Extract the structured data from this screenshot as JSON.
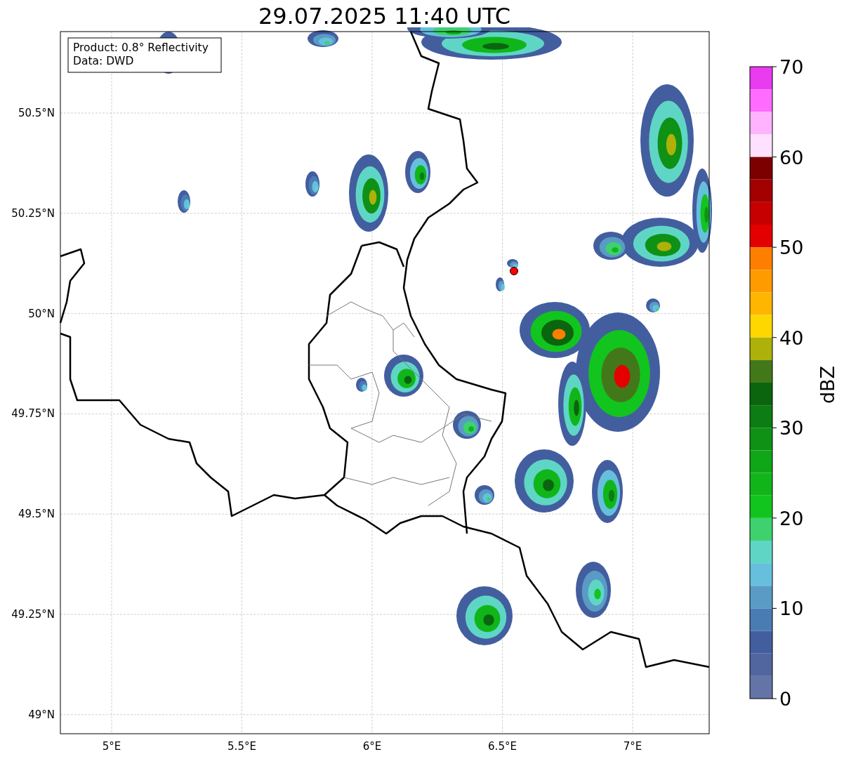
{
  "title": "29.07.2025 11:40 UTC",
  "map": {
    "annotation": [
      "Product: 0.8° Reflectivity",
      "Data: DWD"
    ],
    "lon_ticks": [
      "5°E",
      "5.5°E",
      "6°E",
      "6.5°E",
      "7°E"
    ],
    "lat_ticks": [
      "50.5°N",
      "50.25°N",
      "50°N",
      "49.75°N",
      "49.5°N",
      "49.25°N",
      "49°N"
    ]
  },
  "colorbar": {
    "label": "dBZ",
    "ticks": [
      "70",
      "60",
      "50",
      "40",
      "30",
      "20",
      "10",
      "0"
    ],
    "bins": [
      {
        "color": "#e93bf0"
      },
      {
        "color": "#ff6cff"
      },
      {
        "color": "#ffb3ff"
      },
      {
        "color": "#ffe0ff"
      },
      {
        "color": "#7c0000"
      },
      {
        "color": "#a30000"
      },
      {
        "color": "#c60000"
      },
      {
        "color": "#e40000"
      },
      {
        "color": "#fe7f00"
      },
      {
        "color": "#fe9b00"
      },
      {
        "color": "#feb600"
      },
      {
        "color": "#fed700"
      },
      {
        "color": "#adb10a"
      },
      {
        "color": "#43781a"
      },
      {
        "color": "#0a650e"
      },
      {
        "color": "#0d7c12"
      },
      {
        "color": "#0f9115"
      },
      {
        "color": "#0fa617"
      },
      {
        "color": "#10b619"
      },
      {
        "color": "#12c41e"
      },
      {
        "color": "#3dd26e"
      },
      {
        "color": "#5fd6c5"
      },
      {
        "color": "#66c0dd"
      },
      {
        "color": "#5a9bc6"
      },
      {
        "color": "#4a7cb4"
      },
      {
        "color": "#435e9f"
      },
      {
        "color": "#51669e"
      },
      {
        "color": "#6474a6"
      }
    ]
  }
}
